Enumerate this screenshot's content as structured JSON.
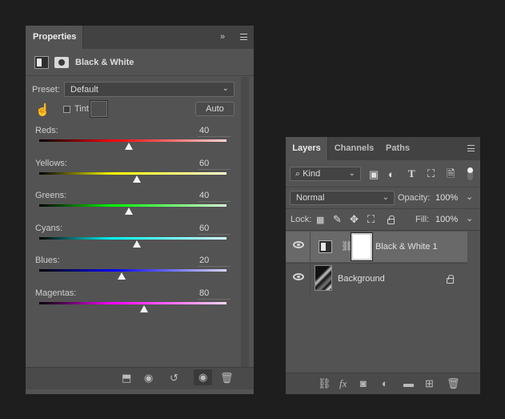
{
  "properties": {
    "tab_label": "Properties",
    "collapse_glyph": "»",
    "adjustment_title": "Black & White",
    "preset_label": "Preset:",
    "preset_value": "Default",
    "tint_label": "Tint",
    "auto_label": "Auto",
    "sliders": [
      {
        "name": "Reds:",
        "value": "40",
        "level": 40
      },
      {
        "name": "Yellows:",
        "value": "60",
        "level": 60
      },
      {
        "name": "Greens:",
        "value": "40",
        "level": 40
      },
      {
        "name": "Cyans:",
        "value": "60",
        "level": 60
      },
      {
        "name": "Blues:",
        "value": "20",
        "level": 20
      },
      {
        "name": "Magentas:",
        "value": "80",
        "level": 80
      }
    ],
    "slider_range": [
      -200,
      300
    ],
    "gradients": {
      "reds": [
        "#000000",
        "#ff0000",
        "#ffd6d6"
      ],
      "yellows": [
        "#000000",
        "#ffff00",
        "#ffffd6"
      ],
      "greens": [
        "#000000",
        "#00ff00",
        "#d6ffd6"
      ],
      "cyans": [
        "#000000",
        "#00ffff",
        "#d6ffff"
      ],
      "blues": [
        "#000000",
        "#0000ff",
        "#d6d6ff"
      ],
      "magentas": [
        "#000000",
        "#ff00ff",
        "#ffd6ff"
      ]
    },
    "bottom_icons": [
      "clip-to-layer-icon",
      "view-previous-icon",
      "reset-icon",
      "visibility-icon",
      "trash-icon"
    ]
  },
  "layers": {
    "tabs": [
      {
        "label": "Layers",
        "active": true
      },
      {
        "label": "Channels",
        "active": false
      },
      {
        "label": "Paths",
        "active": false
      }
    ],
    "filter_kind": "Kind",
    "blend_mode": "Normal",
    "opacity_label": "Opacity:",
    "opacity_value": "100%",
    "lock_label": "Lock:",
    "fill_label": "Fill:",
    "fill_value": "100%",
    "items": [
      {
        "name": "Black & White 1",
        "type": "adjustment",
        "selected": true,
        "visible": true
      },
      {
        "name": "Background",
        "type": "image",
        "selected": false,
        "visible": true,
        "locked": true
      }
    ],
    "filter_icons": [
      "image-filter-icon",
      "adjustment-filter-icon",
      "type-filter-icon",
      "shape-filter-icon",
      "smart-object-filter-icon"
    ],
    "lock_icons": [
      "lock-transparent-icon",
      "lock-pixels-icon",
      "lock-position-icon",
      "lock-artboard-icon",
      "lock-all-icon"
    ],
    "bottom_icons": [
      "link-layers-icon",
      "fx-icon",
      "add-mask-icon",
      "new-adjustment-icon",
      "new-group-icon",
      "new-layer-icon",
      "trash-icon"
    ]
  }
}
